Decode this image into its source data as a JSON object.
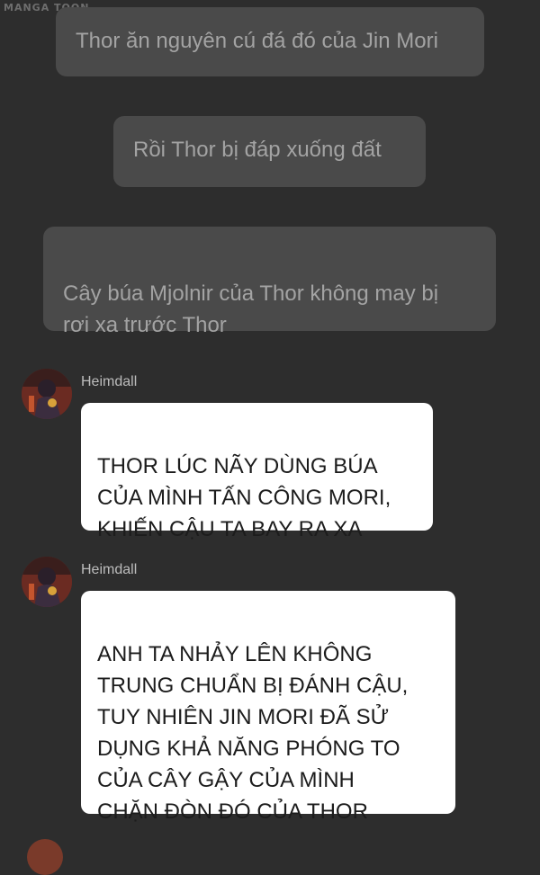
{
  "watermark": "MANGA TOON",
  "narrations": [
    "Thor ăn nguyên cú đá đó của Jin Mori",
    "Rồi Thor bị đáp xuống đất",
    "Cây búa Mjolnir của Thor không may bị\nrơi xa trước Thor"
  ],
  "messages": [
    {
      "speaker": "Heimdall",
      "text": "THOR LÚC NÃY DÙNG BÚA\nCỦA MÌNH TẤN CÔNG MORI,\nKHIẾN CẬU TA BAY RA XA"
    },
    {
      "speaker": "Heimdall",
      "text": "ANH TA NHẢY LÊN KHÔNG\nTRUNG CHUẨN BỊ ĐÁNH CẬU,\nTUY NHIÊN JIN MORI ĐÃ SỬ\nDỤNG KHẢ NĂNG PHÓNG TO\nCỦA CÂY GẬY CỦA MÌNH\nCHẶN ĐÒN ĐÓ CỦA THOR"
    }
  ],
  "colors": {
    "background": "#2d2d2d",
    "narration_bubble": "#4a4a4a",
    "narration_text": "#a3a3a3",
    "dialogue_bubble": "#ffffff",
    "dialogue_text": "#1c1c1c"
  }
}
